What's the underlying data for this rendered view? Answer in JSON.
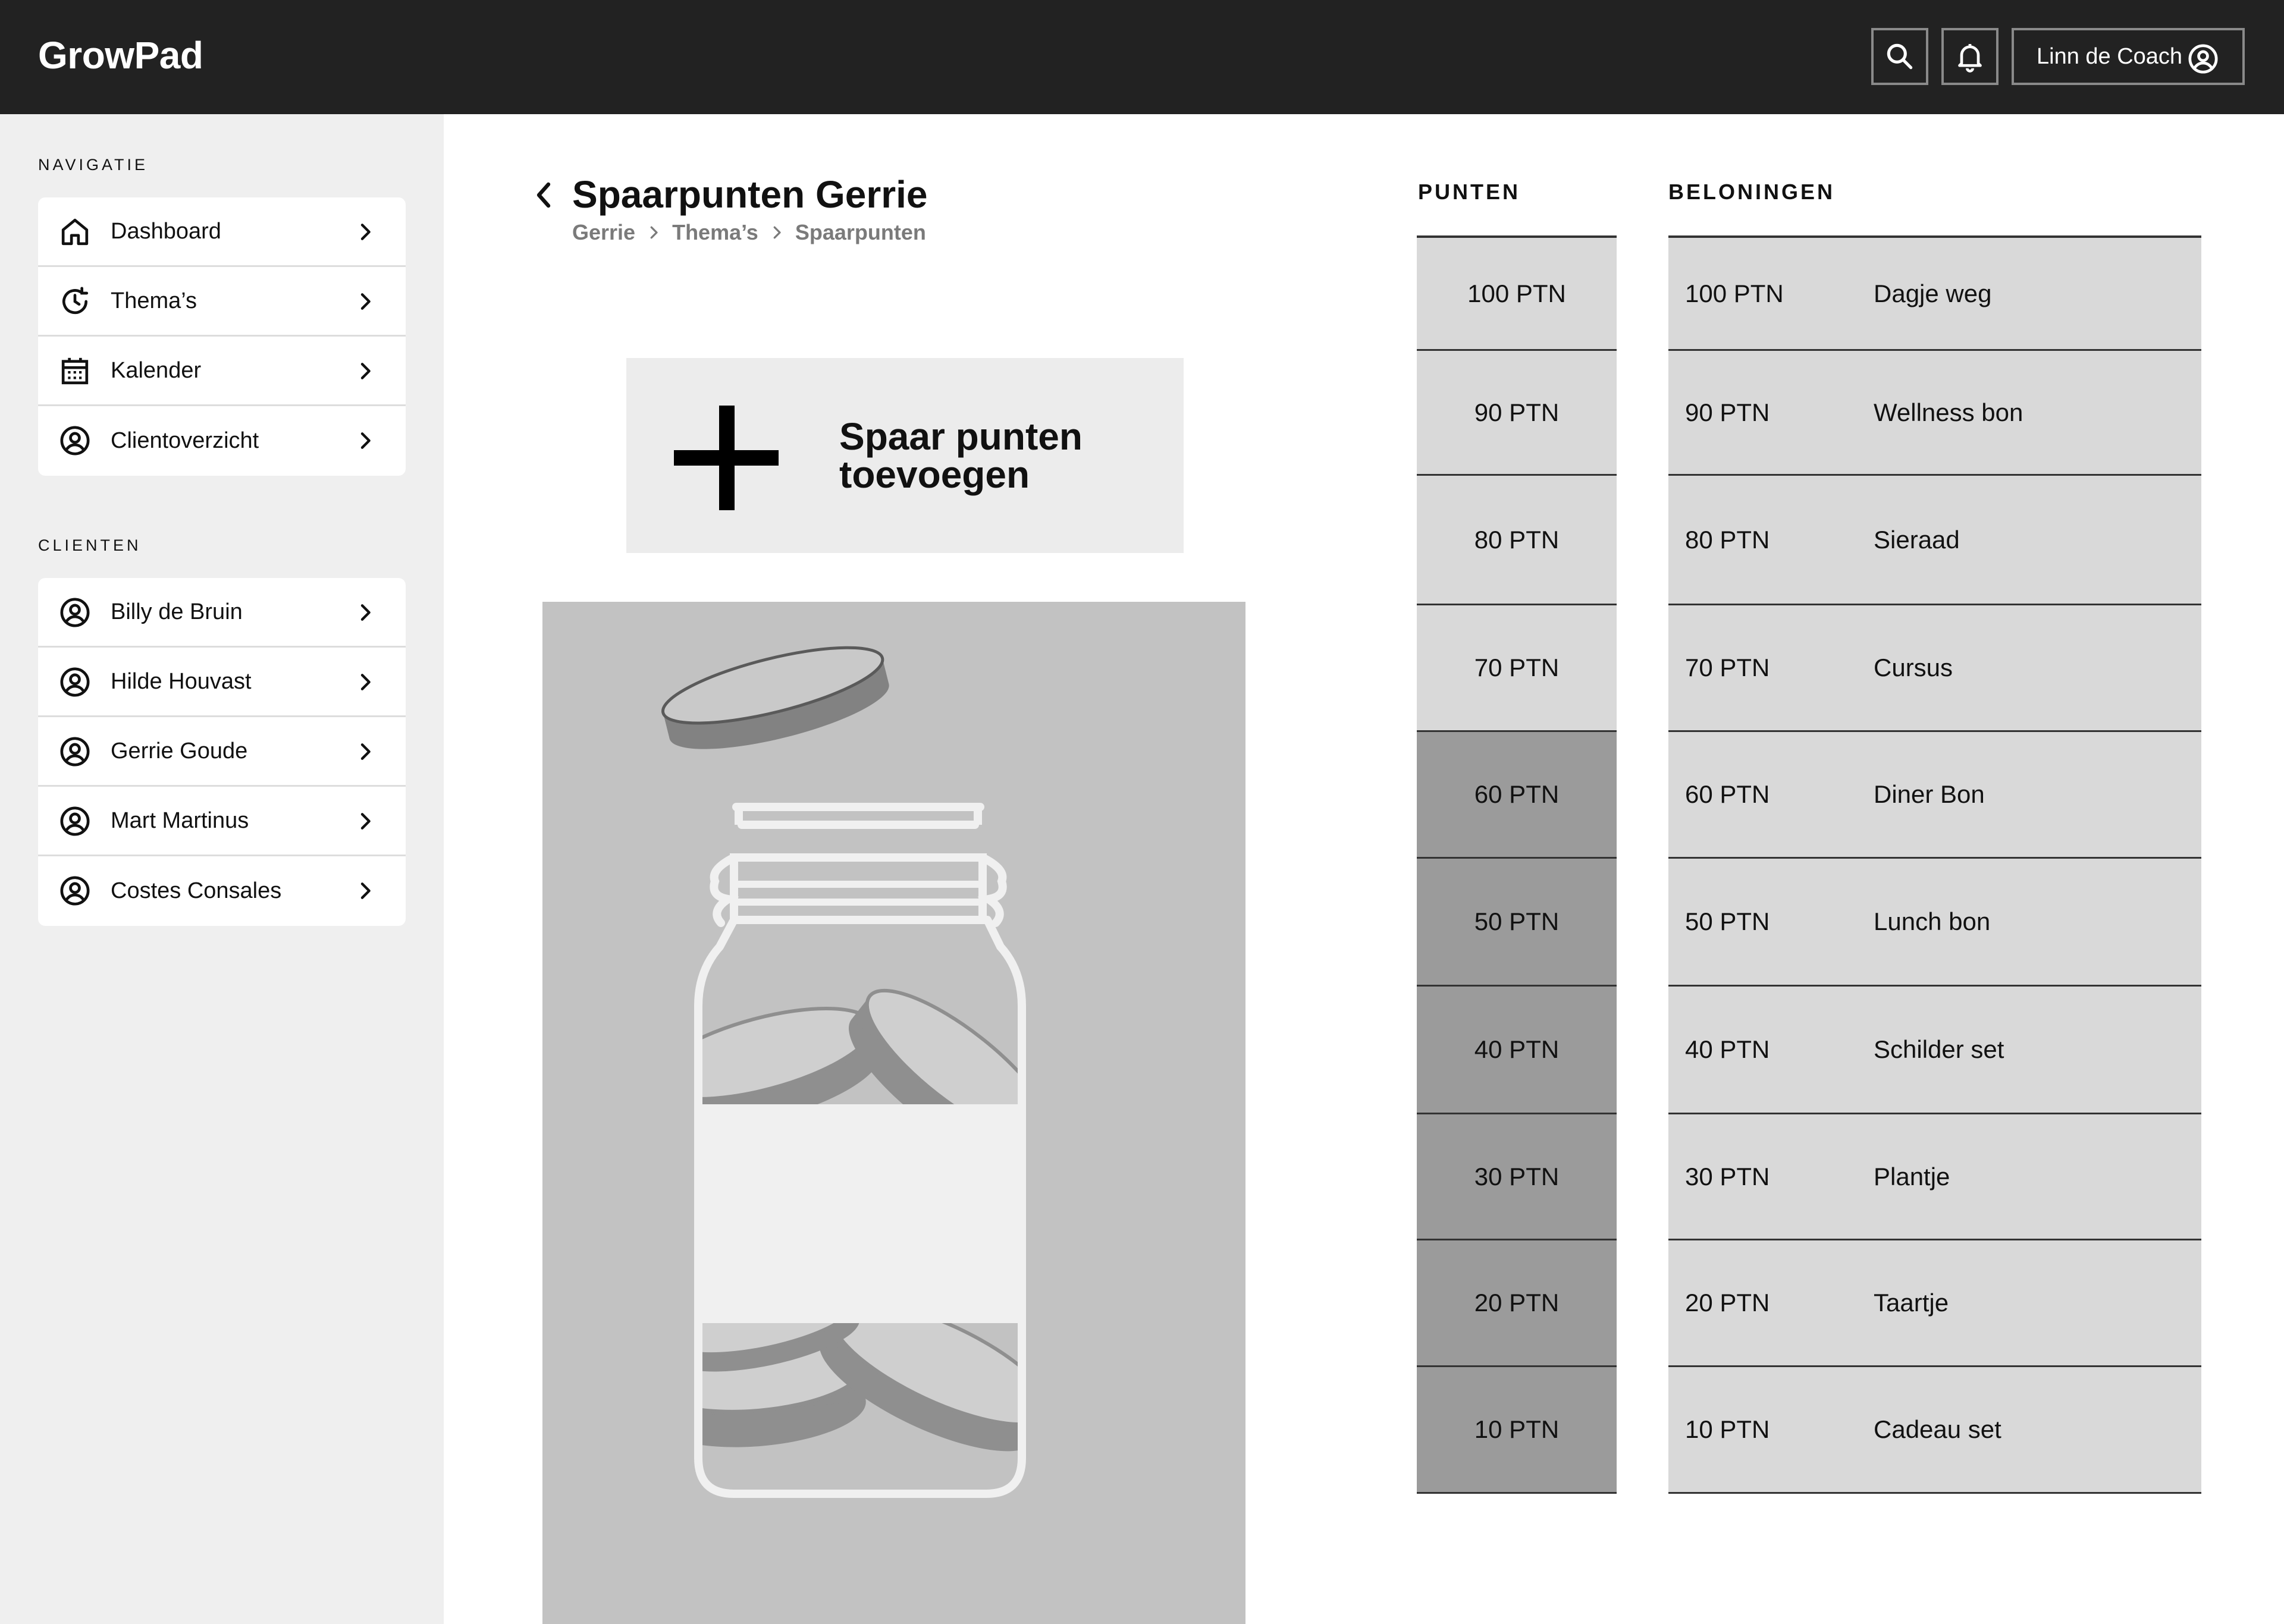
{
  "app": {
    "name": "GrowPad"
  },
  "header": {
    "user_name": "Linn de Coach"
  },
  "sidebar": {
    "nav_label": "NAVIGATIE",
    "nav_items": [
      {
        "label": "Dashboard",
        "icon": "home-icon"
      },
      {
        "label": "Thema’s",
        "icon": "clock-refresh-icon"
      },
      {
        "label": "Kalender",
        "icon": "calendar-icon"
      },
      {
        "label": "Clientoverzicht",
        "icon": "user-circle-icon"
      }
    ],
    "clients_label": "CLIENTEN",
    "clients": [
      {
        "label": "Billy de Bruin",
        "icon": "user-circle-icon"
      },
      {
        "label": "Hilde Houvast",
        "icon": "user-circle-icon"
      },
      {
        "label": "Gerrie Goude",
        "icon": "user-circle-icon"
      },
      {
        "label": "Mart Martinus",
        "icon": "user-circle-icon"
      },
      {
        "label": "Costes Consales",
        "icon": "user-circle-icon"
      }
    ]
  },
  "main": {
    "title": "Spaarpunten Gerrie",
    "breadcrumb": [
      "Gerrie",
      "Thema’s",
      "Spaarpunten"
    ],
    "add_button_label": "Spaar punten toevoegen"
  },
  "points": {
    "header": "PUNTEN",
    "earned": 60,
    "colors": {
      "earned": "#9b9b9b",
      "open": "#d9d9d9"
    },
    "levels": [
      "100 PTN",
      "90 PTN",
      "80 PTN",
      "70 PTN",
      "60 PTN",
      "50 PTN",
      "40 PTN",
      "30 PTN",
      "20 PTN",
      "10 PTN"
    ]
  },
  "rewards": {
    "header": "BELONINGEN",
    "items": [
      {
        "points": "100 PTN",
        "name": "Dagje weg"
      },
      {
        "points": "90 PTN",
        "name": "Wellness bon"
      },
      {
        "points": "80 PTN",
        "name": "Sieraad"
      },
      {
        "points": "70 PTN",
        "name": "Cursus"
      },
      {
        "points": "60 PTN",
        "name": "Diner Bon"
      },
      {
        "points": "50 PTN",
        "name": "Lunch bon"
      },
      {
        "points": "40 PTN",
        "name": "Schilder set"
      },
      {
        "points": "30 PTN",
        "name": "Plantje"
      },
      {
        "points": "20 PTN",
        "name": "Taartje"
      },
      {
        "points": "10 PTN",
        "name": "Cadeau set"
      }
    ]
  }
}
